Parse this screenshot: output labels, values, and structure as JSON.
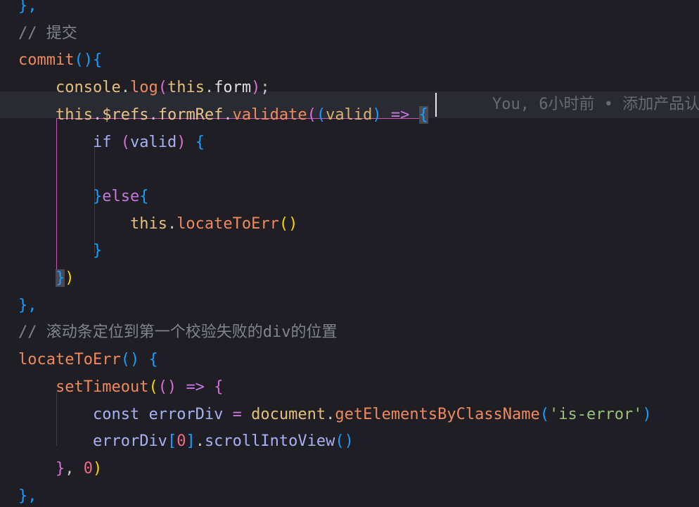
{
  "editor": {
    "lines": [
      {
        "id": "l0",
        "tokens": [
          {
            "t": "},",
            "c": "c-bracket3"
          }
        ]
      },
      {
        "id": "l1",
        "tokens": [
          {
            "t": "// 提交",
            "c": "c-comment"
          }
        ]
      },
      {
        "id": "l2",
        "tokens": [
          {
            "t": "commit",
            "c": "c-fn"
          },
          {
            "t": "()",
            "c": "c-bracket3"
          },
          {
            "t": "{",
            "c": "c-bracket3"
          }
        ]
      },
      {
        "id": "l3",
        "tokens": [
          {
            "t": "    ",
            "c": "c-white"
          },
          {
            "t": "console",
            "c": "c-var"
          },
          {
            "t": ".",
            "c": "c-punct"
          },
          {
            "t": "log",
            "c": "c-fn"
          },
          {
            "t": "(",
            "c": "c-bracket2"
          },
          {
            "t": "this",
            "c": "c-var"
          },
          {
            "t": ".",
            "c": "c-punct"
          },
          {
            "t": "form",
            "c": "c-white"
          },
          {
            "t": ")",
            "c": "c-bracket2"
          },
          {
            "t": ";",
            "c": "c-punct"
          }
        ]
      },
      {
        "id": "l4",
        "tokens": [
          {
            "t": "    ",
            "c": "c-white"
          },
          {
            "t": "this",
            "c": "c-var"
          },
          {
            "t": ".",
            "c": "c-punct"
          },
          {
            "t": "$refs",
            "c": "c-prop"
          },
          {
            "t": ".",
            "c": "c-punct"
          },
          {
            "t": "formRef",
            "c": "c-prop"
          },
          {
            "t": ".",
            "c": "c-punct"
          },
          {
            "t": "validate",
            "c": "c-fn"
          },
          {
            "t": "(",
            "c": "c-bracket2"
          },
          {
            "t": "(",
            "c": "c-bracket3"
          },
          {
            "t": "valid",
            "c": "c-param"
          },
          {
            "t": ")",
            "c": "c-bracket3"
          },
          {
            "t": " ",
            "c": "c-white"
          },
          {
            "t": "=>",
            "c": "c-kw"
          },
          {
            "t": " ",
            "c": "c-white"
          },
          {
            "t": "{",
            "c": "c-bracket3 bracket-hl"
          }
        ]
      },
      {
        "id": "l5",
        "tokens": [
          {
            "t": "        ",
            "c": "c-white"
          },
          {
            "t": "if",
            "c": "c-lav"
          },
          {
            "t": " ",
            "c": "c-white"
          },
          {
            "t": "(",
            "c": "c-bracket2"
          },
          {
            "t": "valid",
            "c": "c-lav"
          },
          {
            "t": ")",
            "c": "c-bracket2"
          },
          {
            "t": " ",
            "c": "c-white"
          },
          {
            "t": "{",
            "c": "c-bracket3"
          }
        ]
      },
      {
        "id": "l6",
        "tokens": [
          {
            "t": "",
            "c": "c-white"
          }
        ]
      },
      {
        "id": "l7",
        "tokens": [
          {
            "t": "        ",
            "c": "c-white"
          },
          {
            "t": "}",
            "c": "c-bracket3"
          },
          {
            "t": "else",
            "c": "c-kw"
          },
          {
            "t": "{",
            "c": "c-bracket3"
          }
        ]
      },
      {
        "id": "l8",
        "tokens": [
          {
            "t": "            ",
            "c": "c-white"
          },
          {
            "t": "this",
            "c": "c-var"
          },
          {
            "t": ".",
            "c": "c-punct"
          },
          {
            "t": "locateToErr",
            "c": "c-fn"
          },
          {
            "t": "()",
            "c": "c-bracket1"
          }
        ]
      },
      {
        "id": "l9",
        "tokens": [
          {
            "t": "        ",
            "c": "c-white"
          },
          {
            "t": "}",
            "c": "c-bracket3"
          }
        ]
      },
      {
        "id": "l10",
        "tokens": [
          {
            "t": "    ",
            "c": "c-white"
          },
          {
            "t": "}",
            "c": "c-bracket3 bracket-hl"
          },
          {
            "t": ")",
            "c": "c-bracket1"
          }
        ]
      },
      {
        "id": "l11",
        "tokens": [
          {
            "t": "},",
            "c": "c-bracket3"
          }
        ]
      },
      {
        "id": "l12",
        "tokens": [
          {
            "t": "// 滚动条定位到第一个校验失败的div的位置",
            "c": "c-comment"
          }
        ]
      },
      {
        "id": "l13",
        "tokens": [
          {
            "t": "locateToErr",
            "c": "c-fn"
          },
          {
            "t": "()",
            "c": "c-bracket3"
          },
          {
            "t": " ",
            "c": "c-white"
          },
          {
            "t": "{",
            "c": "c-bracket3"
          }
        ]
      },
      {
        "id": "l14",
        "tokens": [
          {
            "t": "    ",
            "c": "c-white"
          },
          {
            "t": "setTimeout",
            "c": "c-fn"
          },
          {
            "t": "(",
            "c": "c-bracket1"
          },
          {
            "t": "()",
            "c": "c-bracket2"
          },
          {
            "t": " ",
            "c": "c-white"
          },
          {
            "t": "=>",
            "c": "c-kw"
          },
          {
            "t": " ",
            "c": "c-white"
          },
          {
            "t": "{",
            "c": "c-bracket2"
          }
        ]
      },
      {
        "id": "l15",
        "tokens": [
          {
            "t": "        ",
            "c": "c-white"
          },
          {
            "t": "const",
            "c": "c-lav"
          },
          {
            "t": " ",
            "c": "c-white"
          },
          {
            "t": "errorDiv",
            "c": "c-lav"
          },
          {
            "t": " ",
            "c": "c-white"
          },
          {
            "t": "=",
            "c": "c-kw"
          },
          {
            "t": " ",
            "c": "c-white"
          },
          {
            "t": "document",
            "c": "c-var"
          },
          {
            "t": ".",
            "c": "c-punct"
          },
          {
            "t": "getElementsByClassName",
            "c": "c-fn"
          },
          {
            "t": "(",
            "c": "c-bracket3"
          },
          {
            "t": "'is-error'",
            "c": "c-str"
          },
          {
            "t": ")",
            "c": "c-bracket3"
          }
        ]
      },
      {
        "id": "l16",
        "tokens": [
          {
            "t": "        ",
            "c": "c-white"
          },
          {
            "t": "errorDiv",
            "c": "c-lav"
          },
          {
            "t": "[",
            "c": "c-bracket3"
          },
          {
            "t": "0",
            "c": "c-num"
          },
          {
            "t": "]",
            "c": "c-bracket3"
          },
          {
            "t": ".",
            "c": "c-punct"
          },
          {
            "t": "scrollIntoView",
            "c": "c-lav"
          },
          {
            "t": "()",
            "c": "c-bracket3"
          }
        ]
      },
      {
        "id": "l17",
        "tokens": [
          {
            "t": "    ",
            "c": "c-white"
          },
          {
            "t": "}",
            "c": "c-bracket2"
          },
          {
            "t": ",",
            "c": "c-punct"
          },
          {
            "t": " ",
            "c": "c-white"
          },
          {
            "t": "0",
            "c": "c-num"
          },
          {
            "t": ")",
            "c": "c-bracket1"
          }
        ]
      },
      {
        "id": "l18",
        "tokens": [
          {
            "t": "},",
            "c": "c-bracket3"
          }
        ]
      }
    ],
    "blame": "You, 6小时前 • 添加产品认"
  }
}
